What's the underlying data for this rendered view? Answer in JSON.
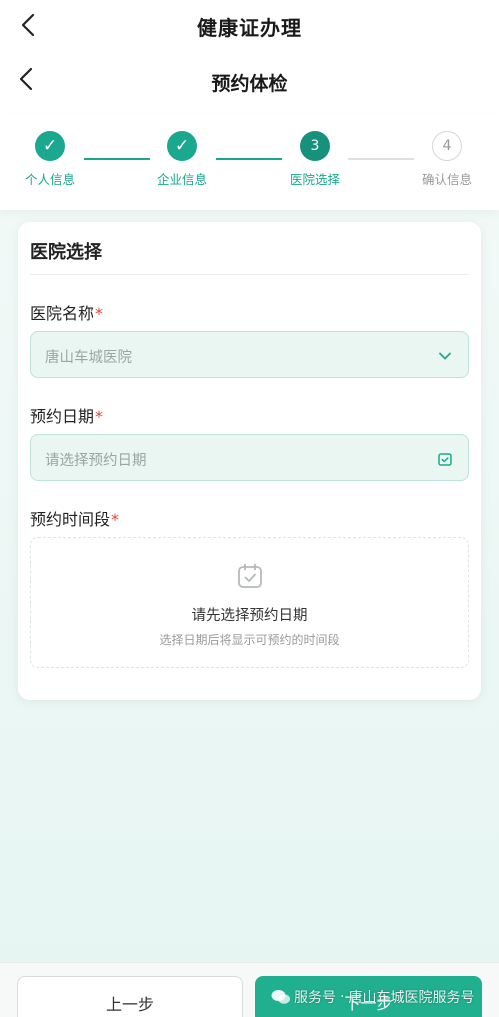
{
  "header": {
    "title": "健康证办理"
  },
  "subheader": {
    "title": "预约体检"
  },
  "steps": [
    {
      "label": "个人信息",
      "status": "done",
      "mark": "✓"
    },
    {
      "label": "企业信息",
      "status": "done",
      "mark": "✓"
    },
    {
      "label": "医院选择",
      "status": "active",
      "mark": "3"
    },
    {
      "label": "确认信息",
      "status": "todo",
      "mark": "4"
    }
  ],
  "card": {
    "title": "医院选择",
    "hospital": {
      "label": "医院名称",
      "required_mark": "*",
      "value": "唐山车城医院",
      "icon": "chevron-down-icon"
    },
    "date": {
      "label": "预约日期",
      "required_mark": "*",
      "placeholder": "请选择预约日期",
      "icon": "calendar-check-icon"
    },
    "timeslot": {
      "label": "预约时间段",
      "required_mark": "*",
      "empty_title": "请先选择预约日期",
      "empty_hint": "选择日期后将显示可预约的时间段",
      "icon": "calendar-check-icon"
    }
  },
  "footer": {
    "prev_label": "上一步",
    "next_label": "下一步"
  },
  "watermark": {
    "icon": "wechat-icon",
    "text1": "服务号",
    "separator": "·",
    "text2": "唐山车城医院服务号"
  },
  "colors": {
    "accent": "#1aa88e",
    "required": "#e0473c",
    "field_bg": "#e9f6f1"
  }
}
